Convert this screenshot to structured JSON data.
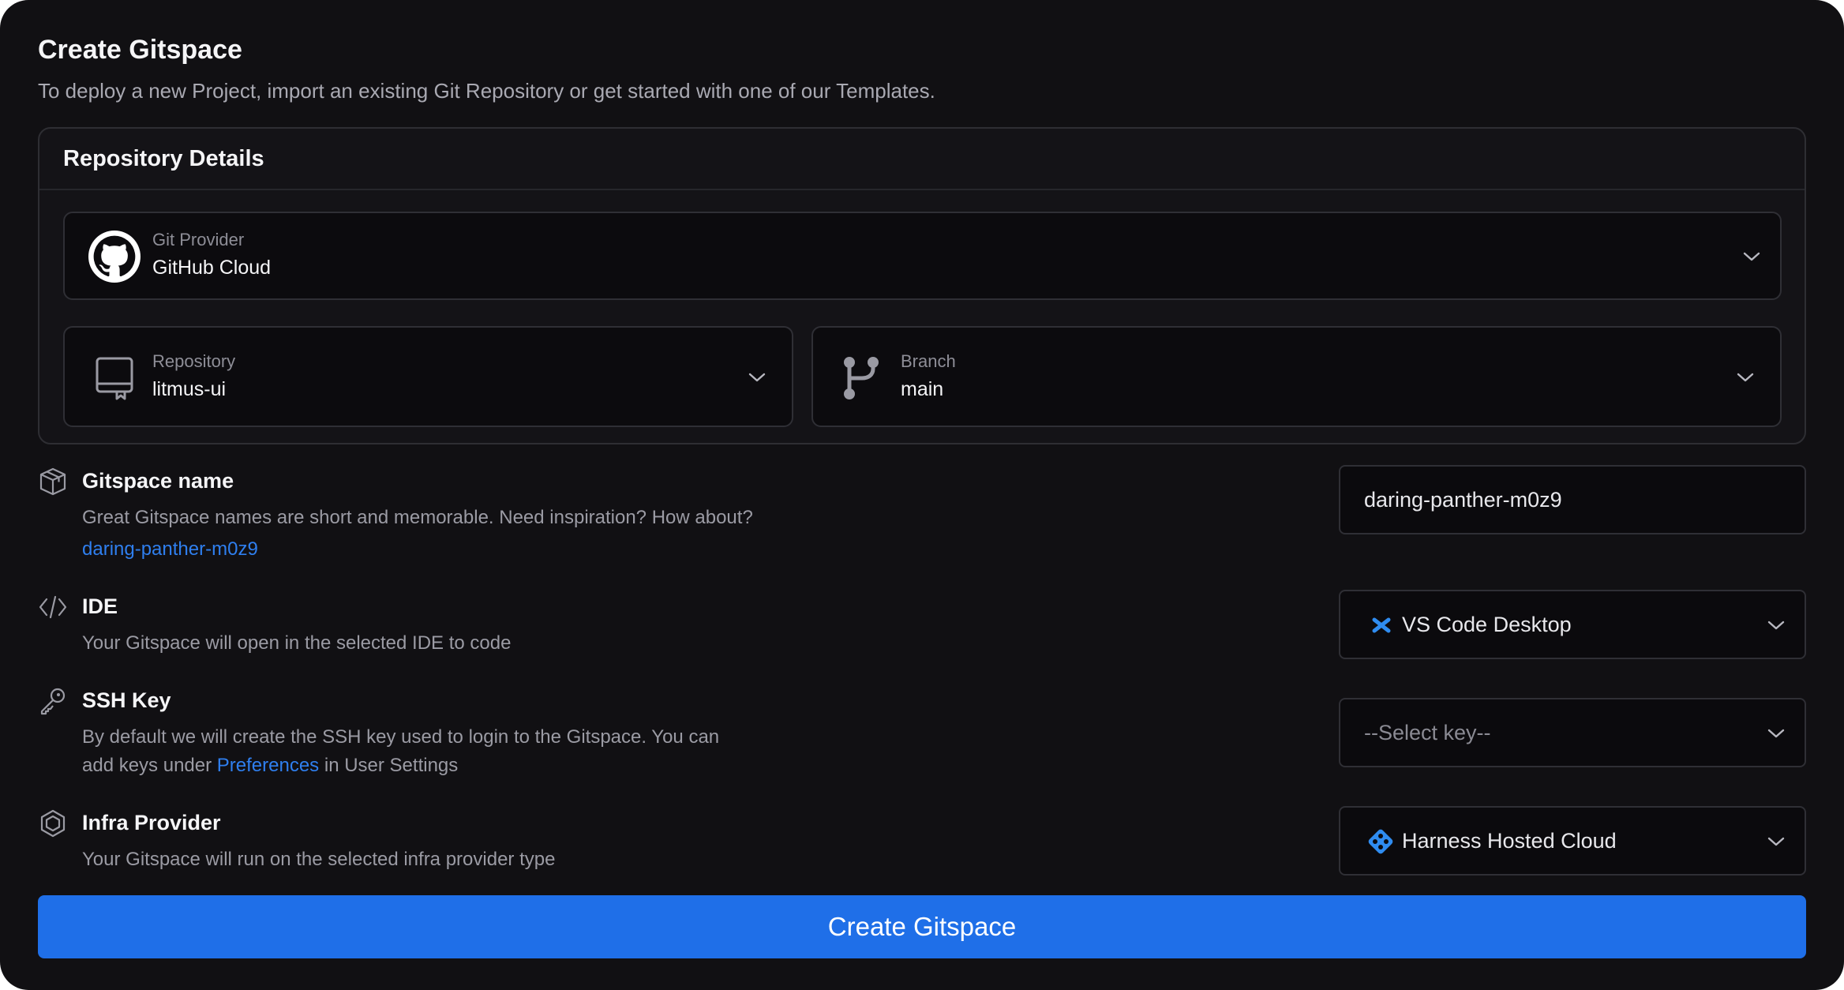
{
  "header": {
    "title": "Create Gitspace",
    "subtitle": "To deploy a new Project, import an existing Git Repository or get started with one of our Templates."
  },
  "repository_details": {
    "heading": "Repository Details",
    "git_provider": {
      "label": "Git Provider",
      "value": "GitHub Cloud",
      "icon": "github-icon"
    },
    "repository": {
      "label": "Repository",
      "value": "litmus-ui",
      "icon": "repo-book-icon"
    },
    "branch": {
      "label": "Branch",
      "value": "main",
      "icon": "git-branch-icon"
    }
  },
  "gitspace_name": {
    "title": "Gitspace name",
    "description": "Great Gitspace names are short and memorable. Need inspiration? How about?",
    "suggestion": "daring-panther-m0z9",
    "input_value": "daring-panther-m0z9",
    "icon": "cube-icon"
  },
  "ide": {
    "title": "IDE",
    "description": "Your Gitspace will open in the selected IDE to code",
    "selected": "VS Code Desktop",
    "icon": "code-icon",
    "option_icon": "vscode-icon"
  },
  "ssh_key": {
    "title": "SSH Key",
    "description_prefix": "By default we will create the SSH key used to login to the Gitspace. You can",
    "description_line2_prefix": "add keys under ",
    "link_text": "Preferences",
    "description_suffix": " in User Settings",
    "placeholder": "--Select key--",
    "icon": "key-icon"
  },
  "infra_provider": {
    "title": "Infra Provider",
    "description": "Your Gitspace will run on the selected infra provider type",
    "selected": "Harness Hosted Cloud",
    "icon": "hexagon-icon",
    "option_icon": "harness-icon"
  },
  "submit": {
    "label": "Create Gitspace"
  },
  "colors": {
    "background": "#111013",
    "primary": "#1f6fe8",
    "link": "#2f7fef",
    "border": "#2f2f35"
  }
}
